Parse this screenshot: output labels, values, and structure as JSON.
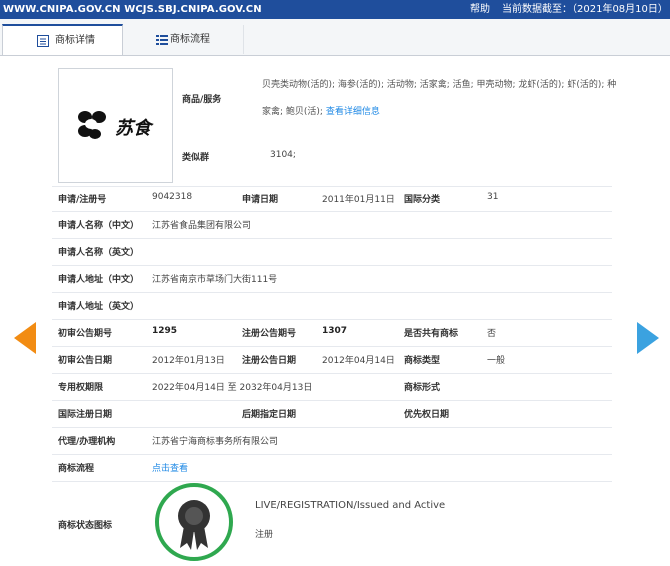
{
  "topbar": {
    "site": "WWW.CNIPA.GOV.CN WCJS.SBJ.CNIPA.GOV.CN",
    "help": "帮助",
    "date": "当前数据截至：（2021年08月10日）"
  },
  "tabs": [
    {
      "label": "商标详情",
      "active": true
    },
    {
      "label": "商标流程",
      "active": false
    }
  ],
  "logo": {
    "text": "苏食"
  },
  "goods": {
    "label": "商品/服务",
    "text": "贝壳类动物(活的); 海参(活的); 活动物; 活家禽; 活鱼; 甲壳动物; 龙虾(活的); 虾(活的); 种家禽; 鲍贝(活);",
    "link": "查看详细信息"
  },
  "similar": {
    "label": "类似群",
    "value": "3104;"
  },
  "rows": {
    "reg_no_label": "申请/注册号",
    "reg_no": "9042318",
    "apply_date_label": "申请日期",
    "apply_date": "2011年01月11日",
    "intl_class_label": "国际分类",
    "intl_class": "31",
    "applicant_cn_label": "申请人名称（中文）",
    "applicant_cn": "江苏省食品集团有限公司",
    "applicant_en_label": "申请人名称（英文）",
    "applicant_en": "",
    "address_cn_label": "申请人地址（中文）",
    "address_cn": "江苏省南京市草场门大街111号",
    "address_en_label": "申请人地址（英文）",
    "address_en": "",
    "prelim_no_label": "初审公告期号",
    "prelim_no": "1295",
    "reg_ann_no_label": "注册公告期号",
    "reg_ann_no": "1307",
    "shared_label": "是否共有商标",
    "shared": "否",
    "prelim_date_label": "初审公告日期",
    "prelim_date": "2012年01月13日",
    "reg_ann_date_label": "注册公告日期",
    "reg_ann_date": "2012年04月14日",
    "type_label": "商标类型",
    "type": "一般",
    "term_label": "专用权期限",
    "term": "2022年04月14日 至 2032年04月13日",
    "form_label": "商标形式",
    "form": "",
    "intl_reg_date_label": "国际注册日期",
    "intl_reg_date": "",
    "later_date_label": "后期指定日期",
    "later_date": "",
    "priority_date_label": "优先权日期",
    "priority_date": "",
    "agent_label": "代理/办理机构",
    "agent": "江苏省宁海商标事务所有限公司",
    "flow_label": "商标流程",
    "flow_link": "点击查看",
    "status_icon_label": "商标状态图标"
  },
  "status": {
    "en": "LIVE/REGISTRATION/Issued and Active",
    "cn": "注册"
  },
  "colors": {
    "topbar": "#1f4e9c",
    "link": "#1e88e5",
    "arrow_left": "#f28c13",
    "arrow_right": "#3ba2e0",
    "badge_ring": "#2fa84f"
  }
}
